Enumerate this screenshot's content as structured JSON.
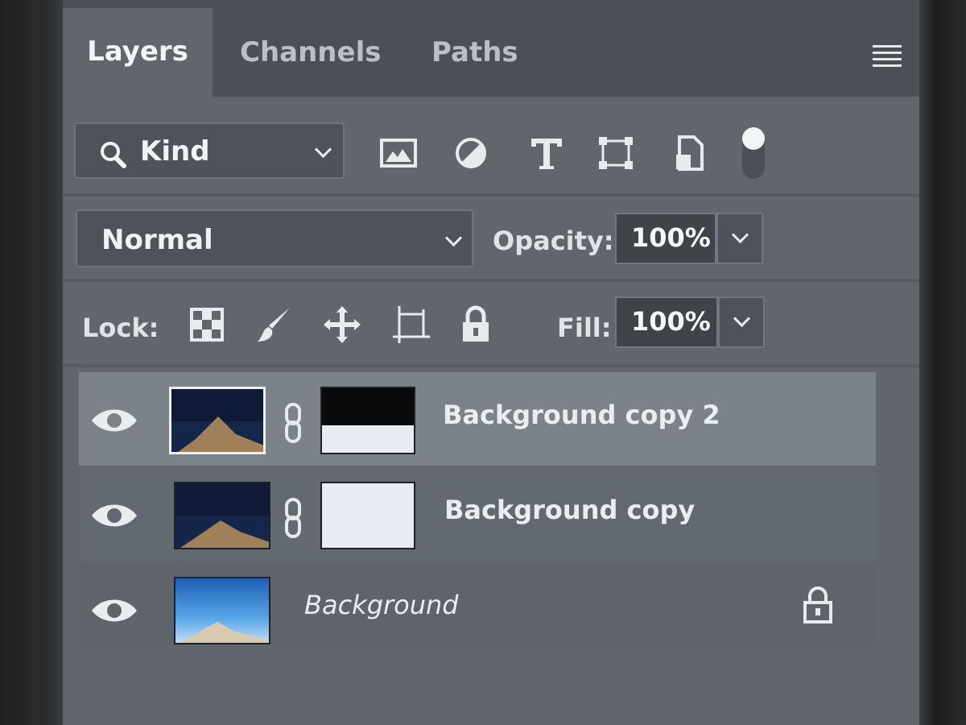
{
  "tabs": [
    {
      "label": "Layers",
      "active": true
    },
    {
      "label": "Channels",
      "active": false
    },
    {
      "label": "Paths",
      "active": false
    }
  ],
  "filter": {
    "kind_label": "Kind",
    "icons": [
      "pixel-layer-filter-icon",
      "adjustment-layer-filter-icon",
      "type-layer-filter-icon",
      "shape-layer-filter-icon",
      "smart-object-filter-icon",
      "filter-toggle-icon"
    ]
  },
  "blend": {
    "mode": "Normal",
    "opacity_label": "Opacity:",
    "opacity_value": "100%"
  },
  "lock": {
    "label": "Lock:",
    "icons": [
      "lock-transparent-pixels-icon",
      "lock-image-pixels-icon",
      "lock-position-icon",
      "lock-artboard-icon",
      "lock-all-icon"
    ],
    "fill_label": "Fill:",
    "fill_value": "100%"
  },
  "layers": [
    {
      "name": "Background copy 2",
      "selected": true,
      "has_mask": true,
      "locked": false
    },
    {
      "name": "Background copy",
      "selected": false,
      "has_mask": true,
      "locked": false
    },
    {
      "name": "Background",
      "selected": false,
      "has_mask": false,
      "locked": true
    }
  ],
  "colors": {
    "panel_bg": "#60666b",
    "tabbar_bg": "#4a5055",
    "selected_row": "#7b8388",
    "text": "#e9edf0"
  }
}
